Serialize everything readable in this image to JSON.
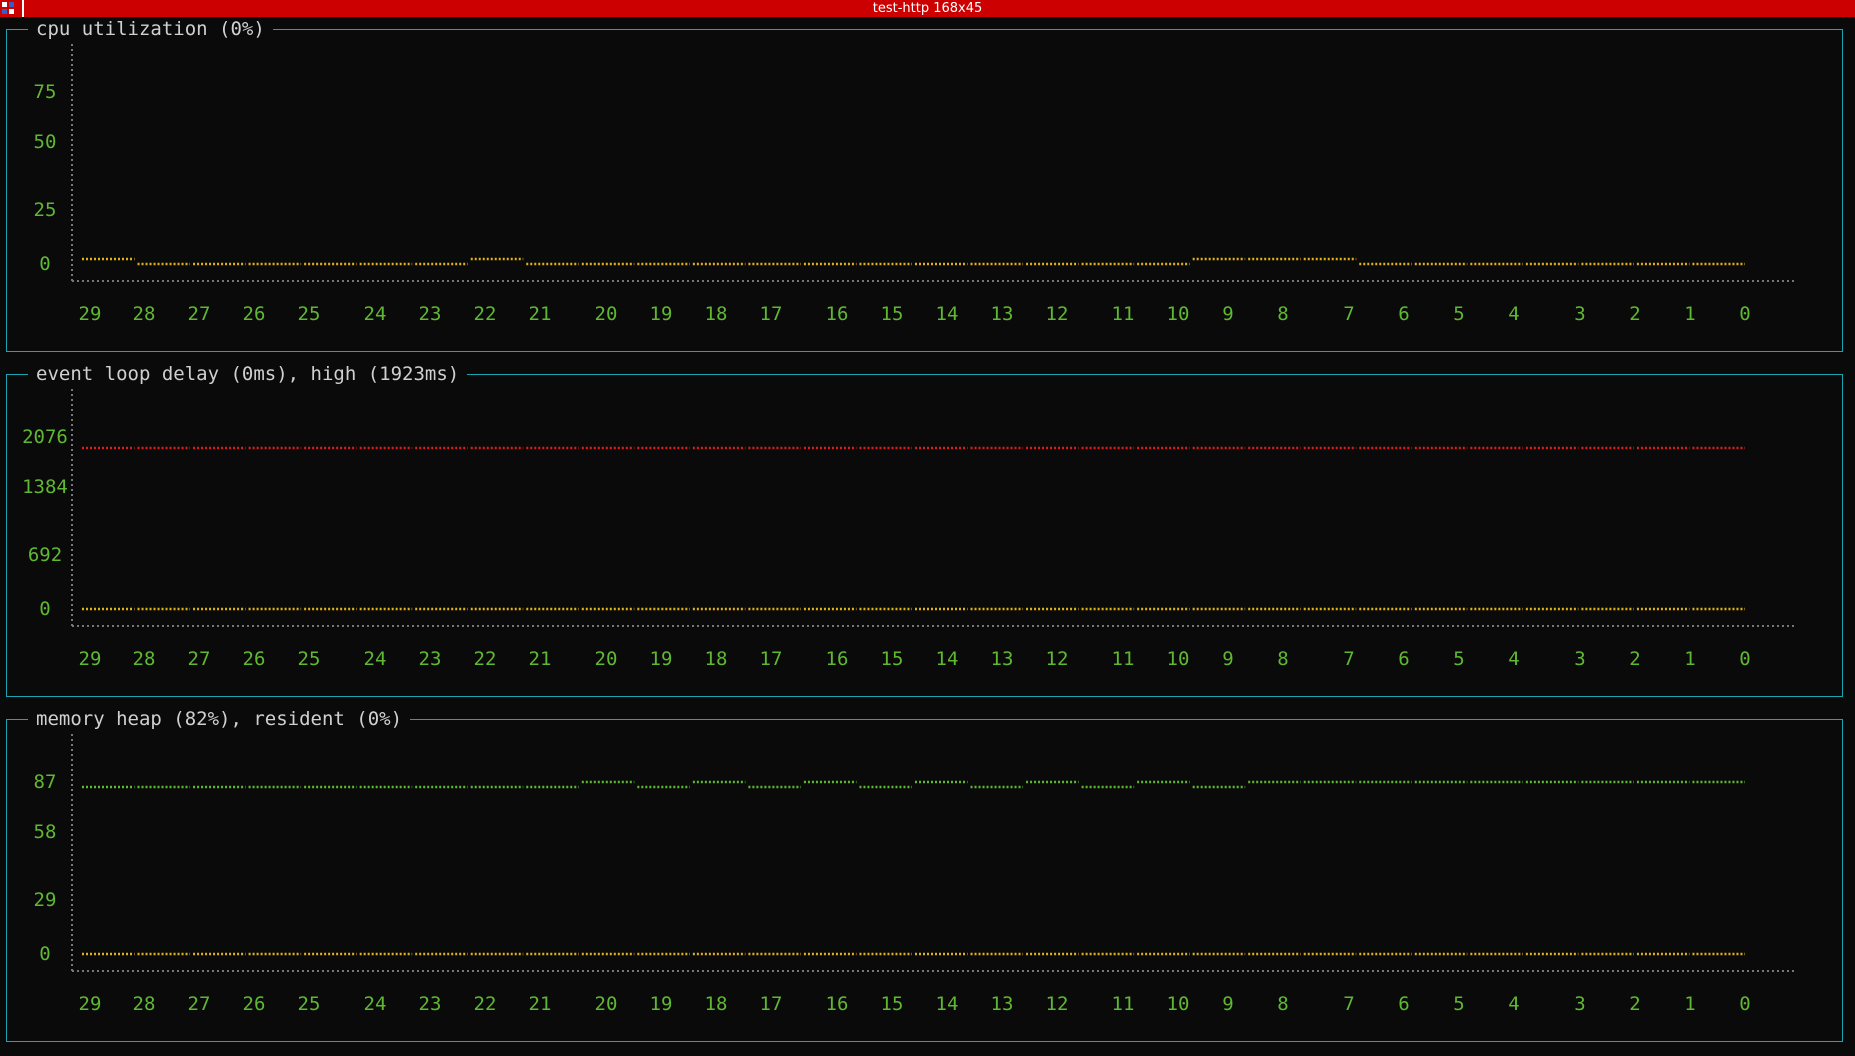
{
  "window": {
    "title": "test-http 168x45"
  },
  "colors": {
    "border": "#1aa5b0",
    "label": "#5fb832",
    "title": "#d0d0d0",
    "axis": "#777777",
    "yellow": "#e0b21a",
    "red": "#dd1c1c",
    "green": "#5fb832"
  },
  "panels": [
    {
      "title": "cpu utilization (0%)"
    },
    {
      "title": "event loop delay (0ms), high (1923ms)"
    },
    {
      "title": "memory heap (82%), resident (0%)"
    }
  ],
  "chart_data": [
    {
      "type": "line",
      "title": "cpu utilization (0%)",
      "x": [
        29,
        28,
        27,
        26,
        25,
        24,
        23,
        22,
        21,
        20,
        19,
        18,
        17,
        16,
        15,
        14,
        13,
        12,
        11,
        10,
        9,
        8,
        7,
        6,
        5,
        4,
        3,
        2,
        1,
        0
      ],
      "y_ticks": [
        0,
        25,
        50,
        75
      ],
      "ylim": [
        0,
        100
      ],
      "series": [
        {
          "color": "yellow",
          "values": [
            2,
            0,
            0,
            0,
            0,
            0,
            0,
            2,
            0,
            0,
            0,
            0,
            0,
            0,
            0,
            0,
            0,
            0,
            0,
            0,
            2,
            2,
            2,
            0,
            0,
            0,
            0,
            0,
            0,
            0
          ]
        }
      ]
    },
    {
      "type": "line",
      "title": "event loop delay (0ms), high (1923ms)",
      "x": [
        29,
        28,
        27,
        26,
        25,
        24,
        23,
        22,
        21,
        20,
        19,
        18,
        17,
        16,
        15,
        14,
        13,
        12,
        11,
        10,
        9,
        8,
        7,
        6,
        5,
        4,
        3,
        2,
        1,
        0
      ],
      "y_ticks": [
        0,
        692,
        1384,
        2076
      ],
      "ylim": [
        0,
        2768
      ],
      "series": [
        {
          "color": "red",
          "values": [
            1923,
            1923,
            1923,
            1923,
            1923,
            1923,
            1923,
            1923,
            1923,
            1923,
            1923,
            1923,
            1923,
            1923,
            1923,
            1923,
            1923,
            1923,
            1923,
            1923,
            1923,
            1923,
            1923,
            1923,
            1923,
            1923,
            1923,
            1923,
            1923,
            1923
          ]
        },
        {
          "color": "yellow",
          "values": [
            0,
            0,
            0,
            0,
            0,
            0,
            0,
            0,
            0,
            0,
            0,
            0,
            0,
            0,
            0,
            0,
            0,
            0,
            0,
            0,
            0,
            0,
            0,
            0,
            0,
            0,
            0,
            0,
            0,
            0
          ]
        }
      ]
    },
    {
      "type": "line",
      "title": "memory heap (82%), resident (0%)",
      "x": [
        29,
        28,
        27,
        26,
        25,
        24,
        23,
        22,
        21,
        20,
        19,
        18,
        17,
        16,
        15,
        14,
        13,
        12,
        11,
        10,
        9,
        8,
        7,
        6,
        5,
        4,
        3,
        2,
        1,
        0
      ],
      "y_ticks": [
        0,
        29,
        58,
        87
      ],
      "ylim": [
        0,
        116
      ],
      "series": [
        {
          "color": "green",
          "values": [
            82,
            82,
            82,
            82,
            82,
            82,
            82,
            82,
            82,
            85,
            82,
            85,
            82,
            85,
            82,
            85,
            82,
            85,
            82,
            85,
            82,
            85,
            85,
            85,
            85,
            85,
            85,
            85,
            85,
            85
          ]
        },
        {
          "color": "yellow",
          "values": [
            0,
            0,
            0,
            0,
            0,
            0,
            0,
            0,
            0,
            0,
            0,
            0,
            0,
            0,
            0,
            0,
            0,
            0,
            0,
            0,
            0,
            0,
            0,
            0,
            0,
            0,
            0,
            0,
            0,
            0
          ]
        }
      ]
    }
  ]
}
